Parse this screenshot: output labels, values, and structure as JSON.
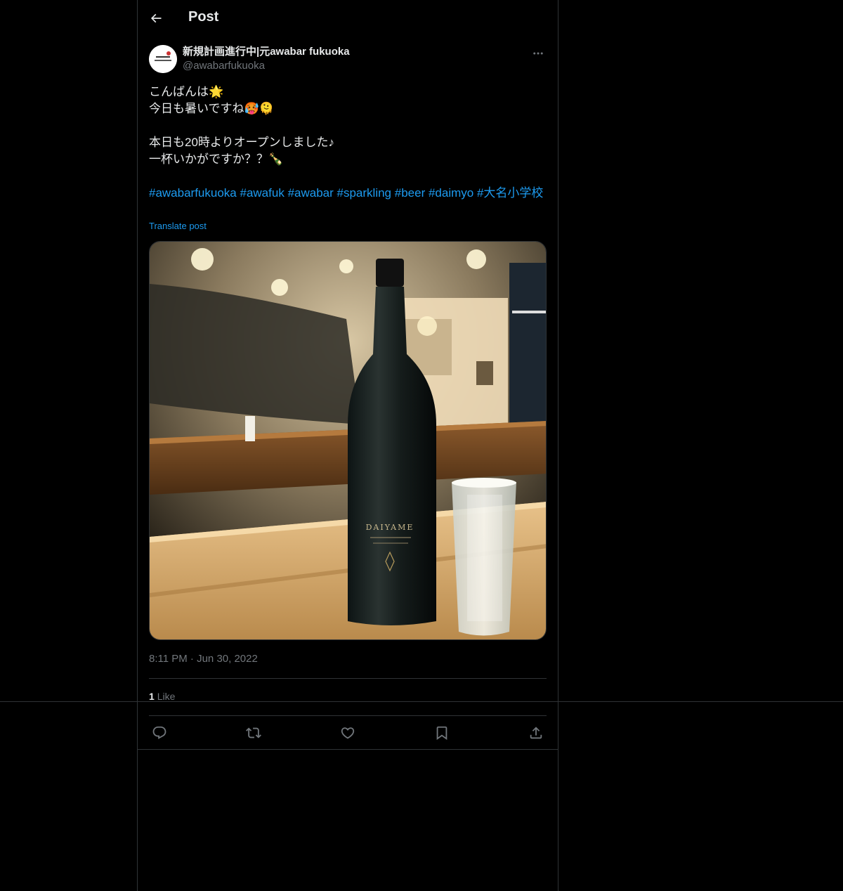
{
  "header": {
    "title": "Post"
  },
  "author": {
    "display_name": "新規計画進行中|元awabar fukuoka",
    "handle": "@awabarfukuoka"
  },
  "post": {
    "text": "こんばんは🌟\n今日も暑いですね🥵🫠\n\n本日も20時よりオープンしました♪\n一杯いかがですか？？🍾",
    "hashtags": [
      "#awabarfukuoka",
      "#awafuk",
      "#awabar",
      "#sparkling",
      "#beer",
      "#daimyo",
      "#大名小学校"
    ],
    "translate_label": "Translate post",
    "time": "8:11 PM",
    "date": "Jun 30, 2022",
    "likes_count": "1",
    "likes_label": "Like",
    "image_bottle_label": "DAIYAME"
  },
  "icons": {
    "back": "arrow-left-icon",
    "more": "ellipsis-icon",
    "reply": "reply-icon",
    "repost": "repost-icon",
    "like": "heart-icon",
    "bookmark": "bookmark-icon",
    "share": "share-icon"
  },
  "colors": {
    "background": "#000000",
    "text": "#e7e9ea",
    "muted": "#71767b",
    "link": "#1d9bf0",
    "border": "#2f3336"
  }
}
